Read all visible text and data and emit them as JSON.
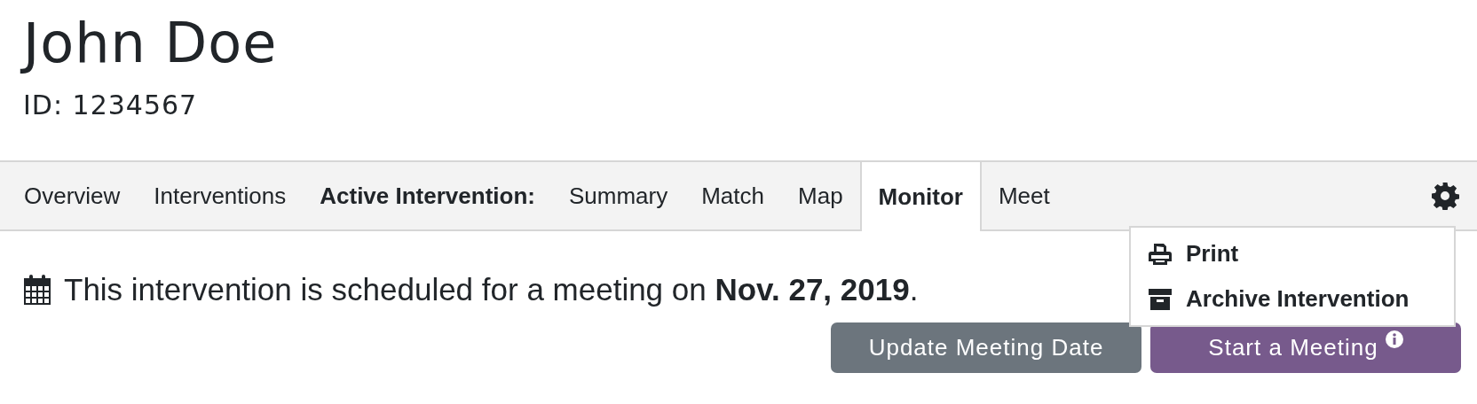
{
  "person": {
    "name": "John Doe",
    "id_line": "ID: 1234567"
  },
  "nav_items": [
    {
      "kind": "tab",
      "label": "Overview",
      "selected": false
    },
    {
      "kind": "tab",
      "label": "Interventions",
      "selected": false
    },
    {
      "kind": "label",
      "label": "Active Intervention:"
    },
    {
      "kind": "tab",
      "label": "Summary",
      "selected": false
    },
    {
      "kind": "tab",
      "label": "Match",
      "selected": false
    },
    {
      "kind": "tab",
      "label": "Map",
      "selected": false
    },
    {
      "kind": "tab",
      "label": "Monitor",
      "selected": true
    },
    {
      "kind": "tab",
      "label": "Meet",
      "selected": false
    }
  ],
  "settings_menu": {
    "expanded": true,
    "items": [
      {
        "label": "Print"
      },
      {
        "label": "Archive Intervention"
      }
    ]
  },
  "message": "This intervention is scheduled for a meeting on **Nov. 27, 2019**.",
  "buttons": [
    {
      "kind": "secondary",
      "label": "Update Meeting Date"
    },
    {
      "kind": "primary",
      "label": "Start a Meeting",
      "info": true
    }
  ]
}
